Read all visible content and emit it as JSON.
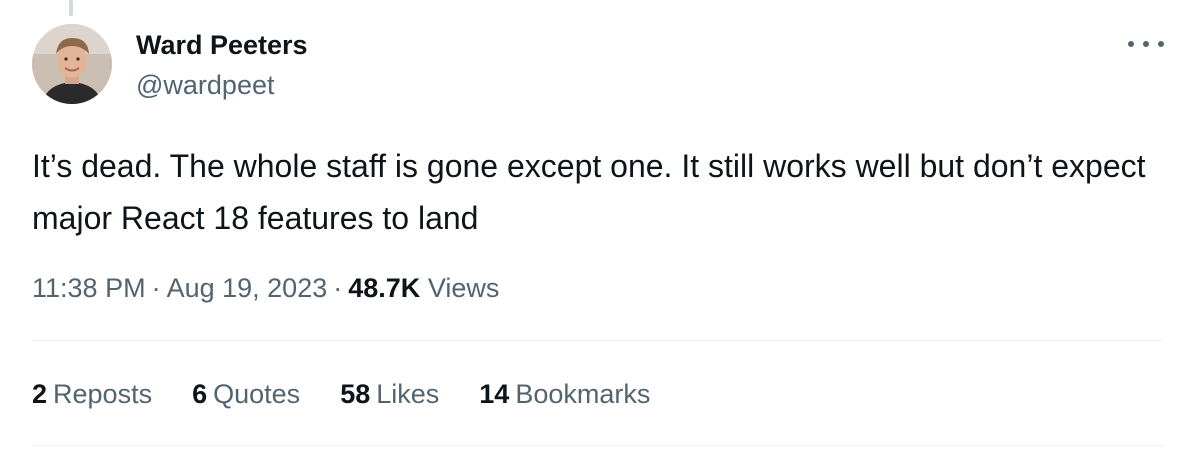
{
  "author": {
    "display_name": "Ward Peeters",
    "handle": "@wardpeet"
  },
  "tweet": {
    "text": "It’s dead. The whole staff is gone except one. It still works well but don’t expect major React 18 features to land",
    "time": "11:38 PM",
    "date": "Aug 19, 2023",
    "separator": "·",
    "views_count": "48.7K",
    "views_label": "Views"
  },
  "stats": {
    "reposts": {
      "count": "2",
      "label": "Reposts"
    },
    "quotes": {
      "count": "6",
      "label": "Quotes"
    },
    "likes": {
      "count": "58",
      "label": "Likes"
    },
    "bookmarks": {
      "count": "14",
      "label": "Bookmarks"
    }
  },
  "icons": {
    "more": "more-horizontal-icon"
  },
  "colors": {
    "primary_text": "#0f1419",
    "secondary_text": "#536471",
    "divider": "#eff3f4",
    "thread_line": "#cfd9de"
  }
}
